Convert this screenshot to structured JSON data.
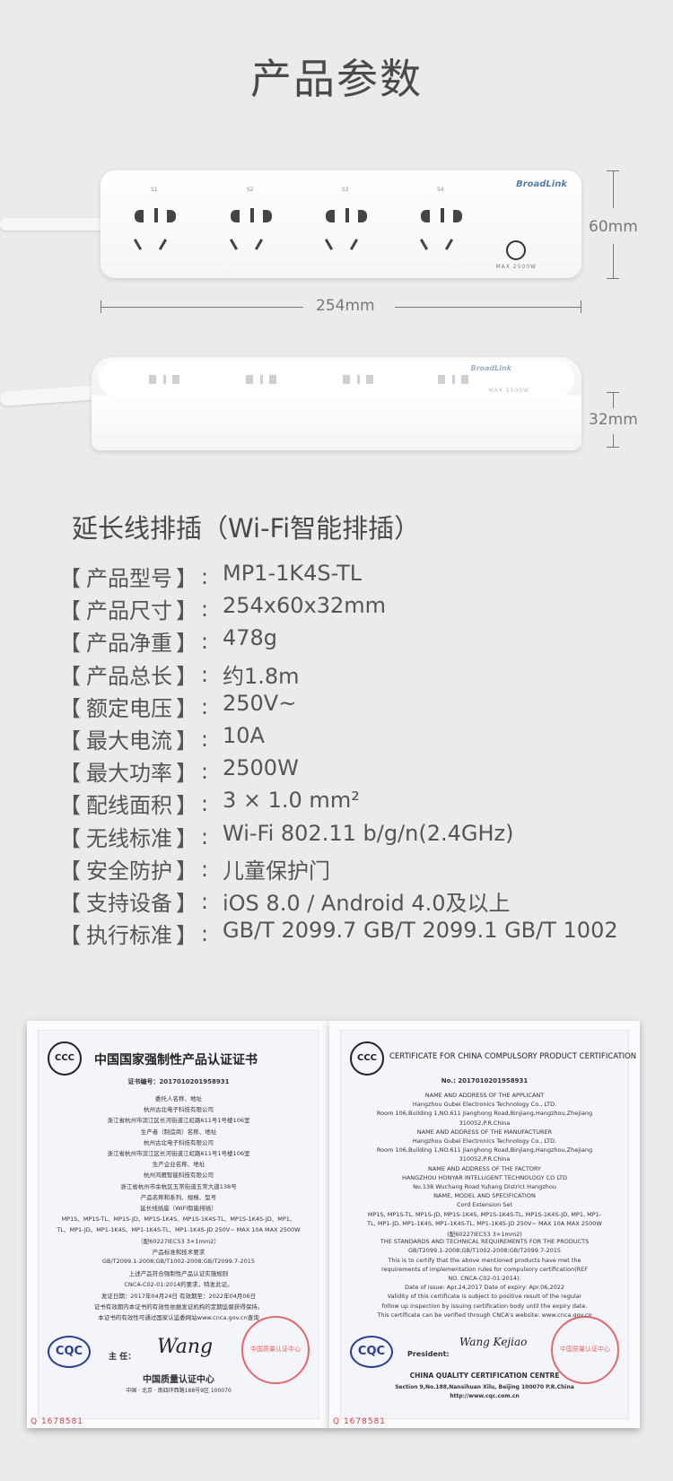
{
  "page_title": "产品参数",
  "product_top": {
    "socket_labels": [
      "S1",
      "S2",
      "S3",
      "S4"
    ],
    "brand": "BroadLink",
    "max_label": "MAX 2500W",
    "dim_height": "60mm",
    "dim_width": "254mm"
  },
  "product_side": {
    "brand": "BroadLink",
    "max_label": "MAX 2500W",
    "dim_depth": "32mm"
  },
  "spec_title": "延长线排插（Wi-Fi智能排插）",
  "specs": [
    {
      "name": "产品型号",
      "value": "MP1-1K4S-TL"
    },
    {
      "name": "产品尺寸",
      "value": "254x60x32mm"
    },
    {
      "name": "产品净重",
      "value": "478g"
    },
    {
      "name": "产品总长",
      "value": "约1.8m"
    },
    {
      "name": "额定电压",
      "value": "250V~"
    },
    {
      "name": "最大电流",
      "value": "10A"
    },
    {
      "name": "最大功率",
      "value": "2500W"
    },
    {
      "name": "配线面积",
      "value": "3 × 1.0 mm²"
    },
    {
      "name": "无线标准",
      "value": "Wi-Fi 802.11 b/g/n(2.4GHz)"
    },
    {
      "name": "安全防护",
      "value": "儿童保护门"
    },
    {
      "name": "支持设备",
      "value": "iOS 8.0 / Android 4.0及以上"
    },
    {
      "name": "执行标准",
      "value": "GB/T 2099.7 GB/T 2099.1 GB/T 1002"
    }
  ],
  "spec_brackets": {
    "left": "【",
    "right": "】",
    "colon": ":"
  },
  "cert_cn": {
    "logo": "CCC",
    "title": "中国国家强制性产品认证证书",
    "number": "证书编号：2017010201958931",
    "lines": [
      "委托人名称、地址",
      "杭州古北电子科技有限公司",
      "浙江省杭州市滨江区长河街道江虹路611号1号楼106室",
      "生产者（制造商）名称、地址",
      "杭州古北电子科技有限公司",
      "浙江省杭州市滨江区长河街道江虹路611号1号楼106室",
      "生产企业名称、地址",
      "杭州鸿雁智能科技有限公司",
      "浙江省杭州市余杭区五常街道五常大道138号",
      "产品名称和系列、规格、型号",
      "延长线插座（WIFI智能排插）",
      "MP1S、MP1S-TL、MP1S-JD、MP1S-1K4S、MP1S-1K4S-TL、MP1S-1K4S-JD、MP1、",
      "TL、MP1-JD、MP1-1K4S、MP1-1K4S-TL、MP1-1K4S-JD 250V~ MAX 10A MAX 2500W",
      "（配60227IEC53 3×1mm2）",
      "产品标准和技术要求",
      "GB/T2099.1-2008;GB/T1002-2008;GB/T2099.7-2015",
      "上述产品符合强制性产品认证实施规则",
      "CNCA-C02-01:2014的要求，特发此证。",
      "发证日期：2017年04月24日        有效期至：2022年04月06日",
      "证书有效期内本证书的有效性依据发证机构的定期监督获得保持。",
      "本证书的有效性可通过国家认监委网站www.cnca.gov.cn查询"
    ],
    "cqc": "CQC",
    "director_label": "主  任：",
    "signature": "Wang",
    "center": "中国质量认证中心",
    "address": "中国 · 北京 · 南四环西路188号9区 100070",
    "seal": "中国质量认证中心",
    "serial": "Q  1678581"
  },
  "cert_en": {
    "logo": "CCC",
    "title": "CERTIFICATE FOR CHINA COMPULSORY PRODUCT CERTIFICATION",
    "number": "No.: 2017010201958931",
    "lines": [
      "NAME AND ADDRESS OF THE APPLICANT",
      "Hangzhou Gubei Electronics Technology Co., LTD.",
      "Room 106,Building 1,NO.611 Jianghong Road,Binjiang,Hangzhou,Zhejiang",
      "310052,P.R.China",
      "NAME AND ADDRESS OF THE MANUFACTURER",
      "Hangzhou Gubei Electronics Technology Co., LTD.",
      "Room 106,Building 1,NO.611 Jianghong Road,Binjiang,Hangzhou,Zhejiang",
      "310052,P.R.China",
      "NAME AND ADDRESS OF THE FACTORY",
      "HANGZHOU HONYAR INTELLIGENT TECHNOLOGY CO LTD",
      "No.138 Wuchang Road Yuhang District Hangzhou",
      "NAME, MODEL AND SPECIFICATION",
      "Cord Extension Set",
      "MP1S, MP1S-TL, MP1S-JD, MP1S-1K4S, MP1S-1K4S-TL, MP1S-1K4S-JD, MP1, MP1-",
      "TL, MP1-JD, MP1-1K4S, MP1-1K4S-TL, MP1-1K4S-JD 250V~ MAX 10A MAX 2500W",
      "(配60227IEC53 3×1mm2)",
      "THE STANDARDS AND TECHNICAL REQUIREMENTS FOR THE PRODUCTS",
      "GB/T2099.1-2008;GB/T1002-2008;GB/T2099.7-2015",
      "This is to certify that the above mentioned products have met the",
      "requirements of implementation rules for compulsory certification(REF",
      "NO. CNCA-C02-01:2014).",
      "Date of issue: Apr.24,2017      Date of expiry: Apr.06,2022",
      "Validity of this certificate is subject to positive result of the regular",
      "follow up inspection by issuing certification body until the expiry date.",
      "This certificate can be verified through CNCA's website: www.cnca.gov.cn"
    ],
    "cqc": "CQC",
    "president_label": "President:",
    "signature": "Wang Kejiao",
    "center": "CHINA QUALITY CERTIFICATION CENTRE",
    "address": "Section 9,No.188,Nansihuan Xilu, Beijing 100070 P.R.China",
    "website": "http://www.cqc.com.cn",
    "seal": "中国质量认证中心",
    "serial": "Q  1678581"
  }
}
